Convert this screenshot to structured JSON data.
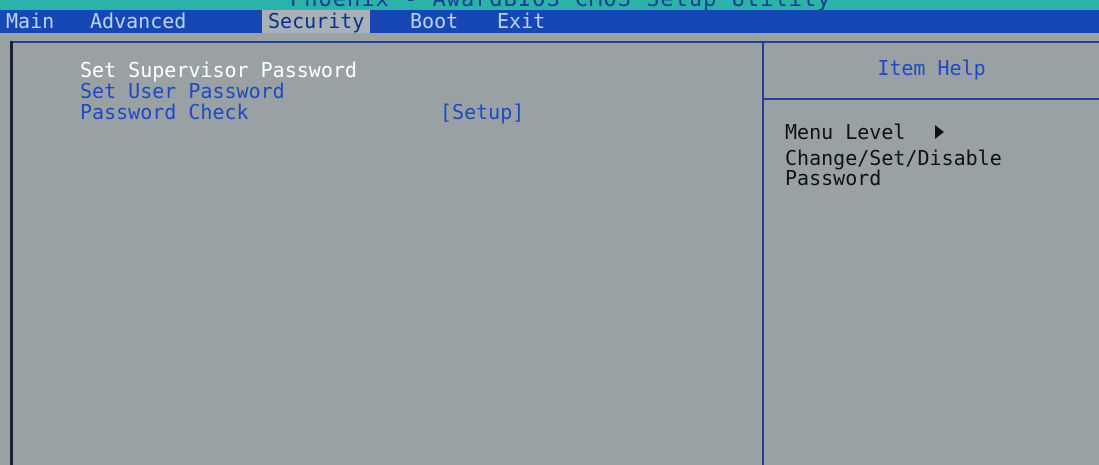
{
  "window": {
    "title": "Phoenix - AwardBIOS CMOS Setup Utility"
  },
  "menu": [
    {
      "label": "Main"
    },
    {
      "label": "Advanced"
    },
    {
      "label": "Security",
      "active": true
    },
    {
      "label": "Boot"
    },
    {
      "label": "Exit"
    }
  ],
  "settings": [
    {
      "label": "Set Supervisor Password",
      "value": "",
      "selected": true
    },
    {
      "label": "Set User Password",
      "value": ""
    },
    {
      "label": "Password Check",
      "value": "[Setup]"
    }
  ],
  "help": {
    "title": "Item Help",
    "menu_level_label": "Menu Level",
    "menu_level_icon": "triangle-right-icon",
    "description_line1": "Change/Set/Disable",
    "description_line2": "Password"
  },
  "colors": {
    "menubar_bg": "#1747b4",
    "title_strip": "#2bb3a9",
    "panel_bg": "#9aa1a4",
    "highlight_text": "#ffffff",
    "item_text": "#1d49c4"
  }
}
